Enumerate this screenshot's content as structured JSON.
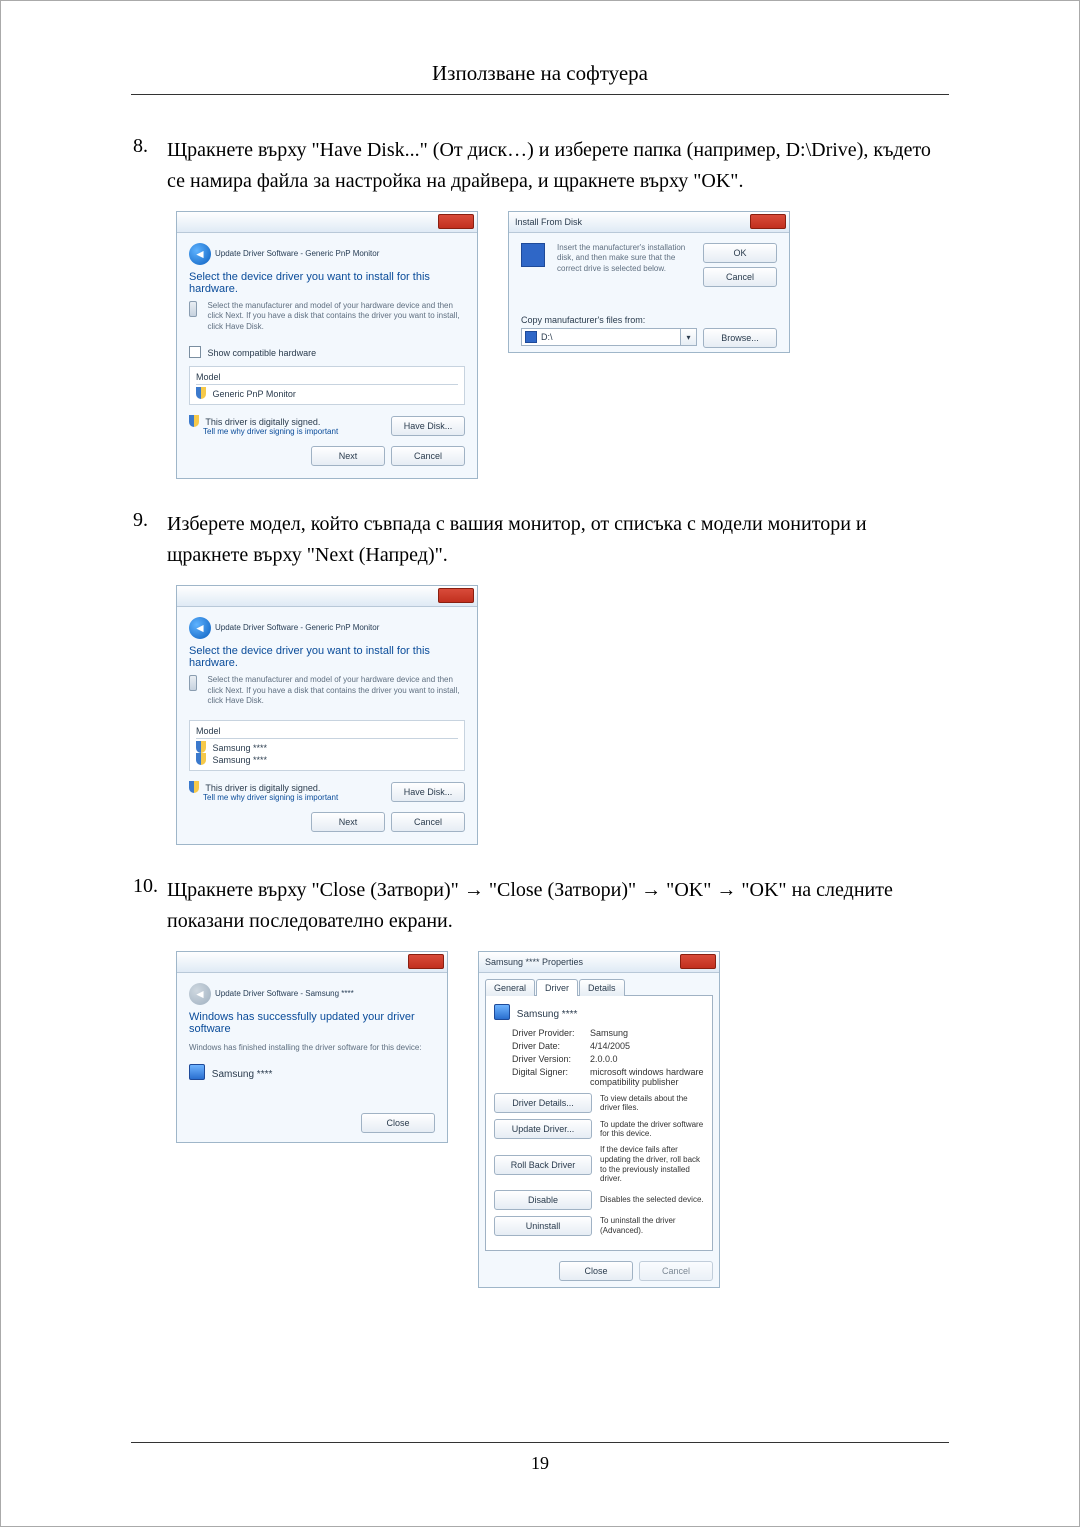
{
  "page": {
    "title": "Използване на софтуера",
    "number": "19"
  },
  "steps": {
    "s8": {
      "num": "8.",
      "text": "Щракнете върху \"Have Disk...\" (От диск…) и изберете папка (например, D:\\Drive), където се намира файла за настройка на драйвера, и щракнете върху \"OK\"."
    },
    "s9": {
      "num": "9.",
      "text": "Изберете модел, който съвпада с вашия монитор, от списъка с модели монитори и щракнете върху \"Next (Напред)\"."
    },
    "s10": {
      "num": "10.",
      "text": "Щракнете върху \"Close (Затвори)\" → \"Close (Затвори)\" → \"OK\" → \"OK\" на следните показани последователно екрани."
    }
  },
  "win1": {
    "breadcrumb": "Update Driver Software - Generic PnP Monitor",
    "heading": "Select the device driver you want to install for this hardware.",
    "desc": "Select the manufacturer and model of your hardware device and then click Next. If you have a disk that contains the driver you want to install, click Have Disk.",
    "compat": "Show compatible hardware",
    "model_label": "Model",
    "model_item": "Generic PnP Monitor",
    "signed": "This driver is digitally signed.",
    "signing_link": "Tell me why driver signing is important",
    "have_disk": "Have Disk...",
    "next": "Next",
    "cancel": "Cancel"
  },
  "win2": {
    "title": "Install From Disk",
    "desc": "Insert the manufacturer's installation disk, and then make sure that the correct drive is selected below.",
    "ok": "OK",
    "cancel": "Cancel",
    "copy_label": "Copy manufacturer's files from:",
    "path": "D:\\",
    "browse": "Browse..."
  },
  "win3": {
    "breadcrumb": "Update Driver Software - Generic PnP Monitor",
    "heading": "Select the device driver you want to install for this hardware.",
    "desc": "Select the manufacturer and model of your hardware device and then click Next. If you have a disk that contains the driver you want to install, click Have Disk.",
    "model_label": "Model",
    "item1": "Samsung ****",
    "item2": "Samsung ****",
    "signed": "This driver is digitally signed.",
    "signing_link": "Tell me why driver signing is important",
    "have_disk": "Have Disk...",
    "next": "Next",
    "cancel": "Cancel"
  },
  "win4": {
    "breadcrumb": "Update Driver Software - Samsung ****",
    "heading": "Windows has successfully updated your driver software",
    "desc": "Windows has finished installing the driver software for this device:",
    "device": "Samsung ****",
    "close": "Close"
  },
  "win5": {
    "title": "Samsung **** Properties",
    "tabs": {
      "general": "General",
      "driver": "Driver",
      "details": "Details"
    },
    "device": "Samsung ****",
    "provider_l": "Driver Provider:",
    "provider_v": "Samsung",
    "date_l": "Driver Date:",
    "date_v": "4/14/2005",
    "version_l": "Driver Version:",
    "version_v": "2.0.0.0",
    "signer_l": "Digital Signer:",
    "signer_v": "microsoft windows hardware compatibility publisher",
    "details_btn": "Driver Details...",
    "details_txt": "To view details about the driver files.",
    "update_btn": "Update Driver...",
    "update_txt": "To update the driver software for this device.",
    "rollback_btn": "Roll Back Driver",
    "rollback_txt": "If the device fails after updating the driver, roll back to the previously installed driver.",
    "disable_btn": "Disable",
    "disable_txt": "Disables the selected device.",
    "uninstall_btn": "Uninstall",
    "uninstall_txt": "To uninstall the driver (Advanced).",
    "close": "Close",
    "cancel": "Cancel"
  }
}
